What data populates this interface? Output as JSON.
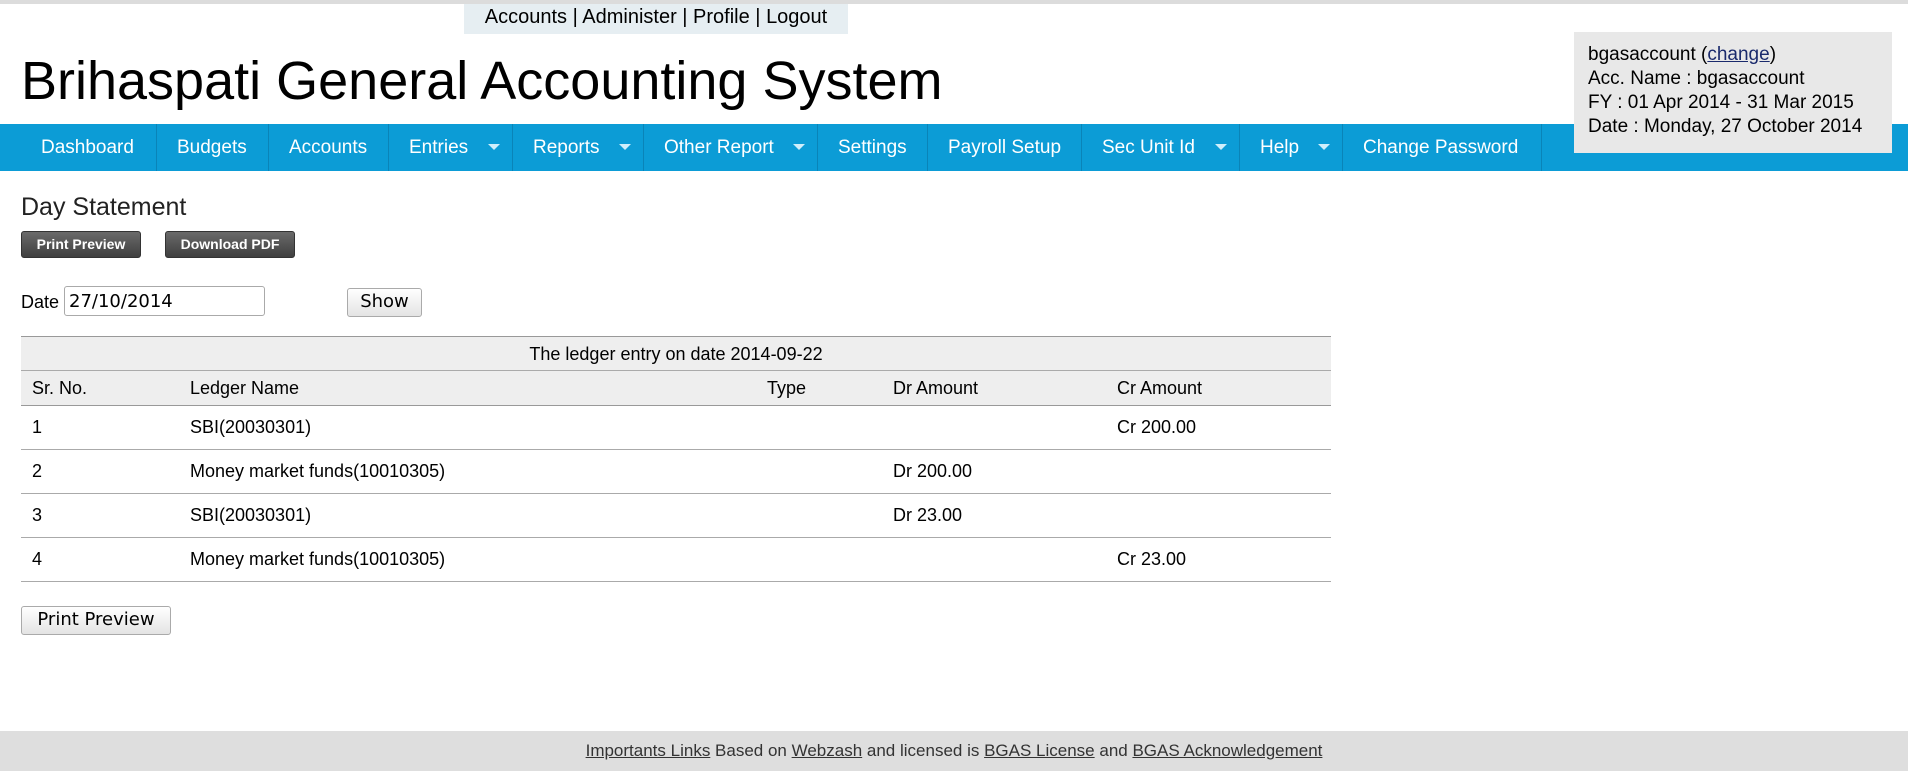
{
  "top_links": {
    "accounts": "Accounts",
    "administer": "Administer",
    "profile": "Profile",
    "logout": "Logout",
    "separator": " | "
  },
  "header": {
    "title": "Brihaspati General Accounting System"
  },
  "user_box": {
    "username": "bgasaccount",
    "change_label": "change",
    "acc_name": "Acc. Name : bgasaccount",
    "fy": "FY : 01 Apr 2014 - 31 Mar 2015",
    "date": "Date : Monday, 27 October 2014"
  },
  "nav": {
    "items": [
      {
        "label": "Dashboard"
      },
      {
        "label": "Budgets"
      },
      {
        "label": "Accounts"
      },
      {
        "label": "Entries"
      },
      {
        "label": "Reports"
      },
      {
        "label": "Other Report"
      },
      {
        "label": "Settings"
      },
      {
        "label": "Payroll Setup"
      },
      {
        "label": "Sec Unit Id"
      },
      {
        "label": "Help"
      },
      {
        "label": "Change Password"
      }
    ]
  },
  "page": {
    "heading": "Day Statement",
    "print_preview_top": "Print Preview",
    "download_pdf": "Download PDF",
    "date_label": "Date",
    "date_value": "27/10/2014",
    "show_button": "Show",
    "print_preview_bottom": "Print Preview"
  },
  "table": {
    "caption": "The ledger entry on date 2014-09-22",
    "headers": {
      "sr": "Sr. No.",
      "ledger": "Ledger Name",
      "type": "Type",
      "dr": "Dr Amount",
      "cr": "Cr Amount"
    },
    "rows": [
      {
        "sr": "1",
        "ledger": "SBI(20030301)",
        "type": "",
        "dr": "",
        "cr": "Cr 200.00"
      },
      {
        "sr": "2",
        "ledger": "Money market funds(10010305)",
        "type": "",
        "dr": "Dr 200.00",
        "cr": ""
      },
      {
        "sr": "3",
        "ledger": "SBI(20030301)",
        "type": "",
        "dr": "Dr 23.00",
        "cr": ""
      },
      {
        "sr": "4",
        "ledger": "Money market funds(10010305)",
        "type": "",
        "dr": "",
        "cr": "Cr 23.00"
      }
    ]
  },
  "footer": {
    "links_label": "Importants Links",
    "based_on": " Based on ",
    "webzash": "Webzash",
    "licensed": " and licensed is ",
    "license": "BGAS License",
    "and": " and ",
    "ack": "BGAS Acknowledgement"
  },
  "colors": {
    "nav_background": "#0c9cd6",
    "user_box_background": "#e8e8e8",
    "footer_background": "#dedede"
  }
}
